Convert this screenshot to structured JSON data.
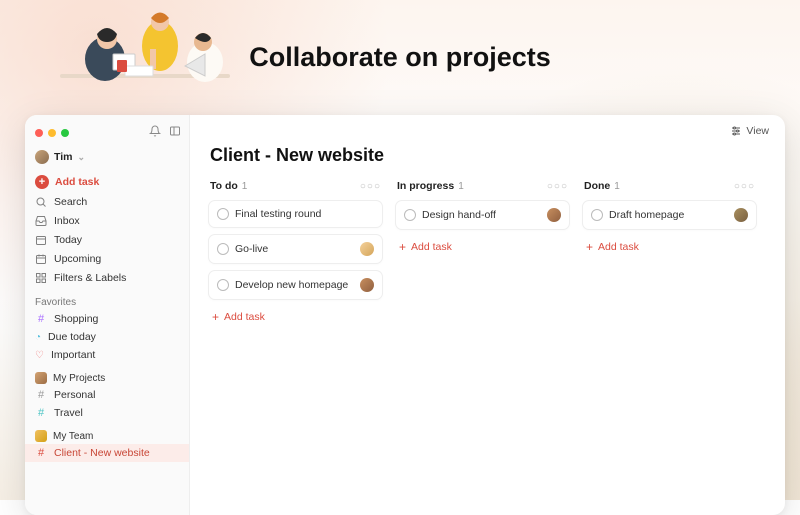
{
  "hero": {
    "title": "Collaborate on projects"
  },
  "user": {
    "name": "Tim"
  },
  "sidebar": {
    "add_task": "Add task",
    "nav": {
      "search": "Search",
      "inbox": "Inbox",
      "today": "Today",
      "upcoming": "Upcoming",
      "filters": "Filters & Labels"
    },
    "favorites_label": "Favorites",
    "favorites": {
      "shopping": "Shopping",
      "due_today": "Due today",
      "important": "Important"
    },
    "my_projects_label": "My Projects",
    "projects": {
      "personal": "Personal",
      "travel": "Travel"
    },
    "my_team_label": "My Team",
    "team_project": "Client - New website"
  },
  "main": {
    "view_label": "View",
    "title": "Client - New website",
    "add_task": "Add task"
  },
  "board": {
    "columns": [
      {
        "title": "To do",
        "count": "1",
        "cards": [
          {
            "title": "Final testing round",
            "assignee": null
          },
          {
            "title": "Go-live",
            "assignee": "a2"
          },
          {
            "title": "Develop new homepage",
            "assignee": "a1"
          }
        ]
      },
      {
        "title": "In progress",
        "count": "1",
        "cards": [
          {
            "title": "Design hand-off",
            "assignee": "a1"
          }
        ]
      },
      {
        "title": "Done",
        "count": "1",
        "cards": [
          {
            "title": "Draft homepage",
            "assignee": "a4"
          }
        ]
      }
    ]
  }
}
